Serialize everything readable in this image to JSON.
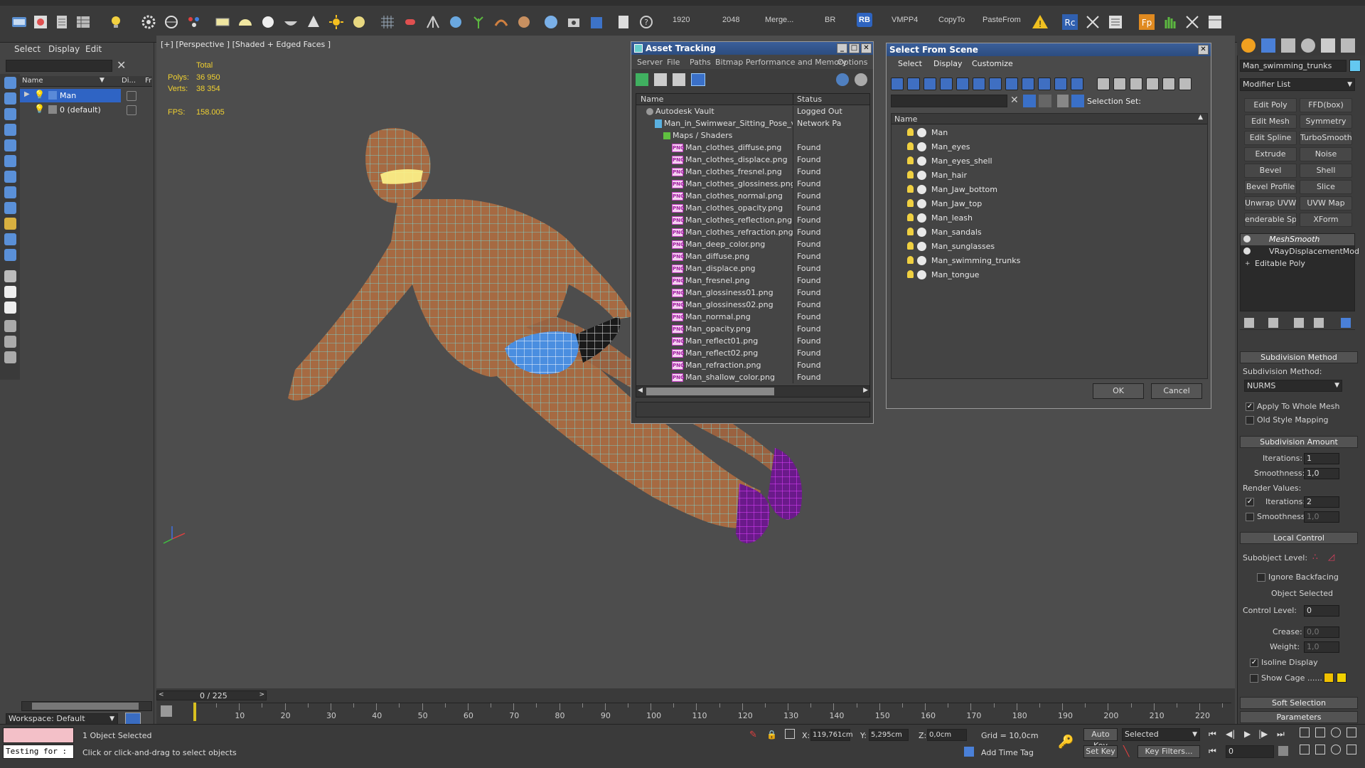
{
  "toolbar": {
    "texts": [
      "1920",
      "2048",
      "Merge...",
      "BR",
      "RB",
      "VMPP4",
      "CopyTo",
      "PasteFrom"
    ]
  },
  "explorer": {
    "menu": [
      "Select",
      "Display",
      "Edit"
    ],
    "col_name": "Name",
    "col_display": "Di...",
    "col_f": "Fr",
    "rows": [
      {
        "label": "Man",
        "selected": true
      },
      {
        "label": "0 (default)",
        "selected": false
      }
    ],
    "workspace": "Workspace: Default"
  },
  "viewport": {
    "label": "[+] [Perspective ] [Shaded + Edged Faces ]",
    "stats": {
      "total_label": "Total",
      "polys_label": "Polys:",
      "polys": "36 950",
      "verts_label": "Verts:",
      "verts": "38 354",
      "fps_label": "FPS:",
      "fps": "158.005"
    }
  },
  "asset_tracking": {
    "title": "Asset Tracking",
    "menu": [
      "Server",
      "File",
      "Paths",
      "Bitmap Performance and Memory",
      "Options"
    ],
    "col_name": "Name",
    "col_status": "Status",
    "rows": [
      {
        "name": "Autodesk Vault",
        "status": "Logged Out",
        "level": 0,
        "kind": "vault"
      },
      {
        "name": "Man_in_Swimwear_Sitting_Pose_vray...",
        "status": "Network Pa",
        "level": 1,
        "kind": "file"
      },
      {
        "name": "Maps / Shaders",
        "status": "",
        "level": 2,
        "kind": "folder"
      },
      {
        "name": "Man_clothes_diffuse.png",
        "status": "Found",
        "level": 3,
        "kind": "png"
      },
      {
        "name": "Man_clothes_displace.png",
        "status": "Found",
        "level": 3,
        "kind": "png"
      },
      {
        "name": "Man_clothes_fresnel.png",
        "status": "Found",
        "level": 3,
        "kind": "png"
      },
      {
        "name": "Man_clothes_glossiness.png",
        "status": "Found",
        "level": 3,
        "kind": "png"
      },
      {
        "name": "Man_clothes_normal.png",
        "status": "Found",
        "level": 3,
        "kind": "png"
      },
      {
        "name": "Man_clothes_opacity.png",
        "status": "Found",
        "level": 3,
        "kind": "png"
      },
      {
        "name": "Man_clothes_reflection.png",
        "status": "Found",
        "level": 3,
        "kind": "png"
      },
      {
        "name": "Man_clothes_refraction.png",
        "status": "Found",
        "level": 3,
        "kind": "png"
      },
      {
        "name": "Man_deep_color.png",
        "status": "Found",
        "level": 3,
        "kind": "png"
      },
      {
        "name": "Man_diffuse.png",
        "status": "Found",
        "level": 3,
        "kind": "png"
      },
      {
        "name": "Man_displace.png",
        "status": "Found",
        "level": 3,
        "kind": "png"
      },
      {
        "name": "Man_fresnel.png",
        "status": "Found",
        "level": 3,
        "kind": "png"
      },
      {
        "name": "Man_glossiness01.png",
        "status": "Found",
        "level": 3,
        "kind": "png"
      },
      {
        "name": "Man_glossiness02.png",
        "status": "Found",
        "level": 3,
        "kind": "png"
      },
      {
        "name": "Man_normal.png",
        "status": "Found",
        "level": 3,
        "kind": "png"
      },
      {
        "name": "Man_opacity.png",
        "status": "Found",
        "level": 3,
        "kind": "png"
      },
      {
        "name": "Man_reflect01.png",
        "status": "Found",
        "level": 3,
        "kind": "png"
      },
      {
        "name": "Man_reflect02.png",
        "status": "Found",
        "level": 3,
        "kind": "png"
      },
      {
        "name": "Man_refraction.png",
        "status": "Found",
        "level": 3,
        "kind": "png"
      },
      {
        "name": "Man_shallow_color.png",
        "status": "Found",
        "level": 3,
        "kind": "png"
      }
    ]
  },
  "select_scene": {
    "title": "Select From Scene",
    "menu": [
      "Select",
      "Display",
      "Customize"
    ],
    "selection_set_label": "Selection Set:",
    "col_name": "Name",
    "items": [
      "Man",
      "Man_eyes",
      "Man_eyes_shell",
      "Man_hair",
      "Man_Jaw_bottom",
      "Man_Jaw_top",
      "Man_leash",
      "Man_sandals",
      "Man_sunglasses",
      "Man_swimming_trunks",
      "Man_tongue"
    ],
    "ok": "OK",
    "cancel": "Cancel"
  },
  "command_panel": {
    "object_name": "Man_swimming_trunks",
    "object_color": "#64c8f0",
    "modifier_list": "Modifier List",
    "mod_buttons": [
      "Edit Poly",
      "FFD(box)",
      "Edit Mesh",
      "Symmetry",
      "Edit Spline",
      "TurboSmooth",
      "Extrude",
      "Noise",
      "Bevel",
      "Shell",
      "Bevel Profile",
      "Slice",
      "Unwrap UVW",
      "UVW Map",
      "enderable Splin",
      "XForm"
    ],
    "stack": [
      "MeshSmooth",
      "VRayDisplacementMod",
      "Editable Poly"
    ],
    "subdiv_method_title": "Subdivision Method",
    "subdiv_method_label": "Subdivision Method:",
    "subdiv_method_value": "NURMS",
    "apply_whole_mesh": "Apply To Whole Mesh",
    "old_style_mapping": "Old Style Mapping",
    "subdiv_amount_title": "Subdivision Amount",
    "iterations_label": "Iterations:",
    "iterations": "1",
    "smoothness_label": "Smoothness:",
    "smoothness": "1,0",
    "render_values_label": "Render Values:",
    "render_iterations_label": "Iterations:",
    "render_iterations": "2",
    "render_smoothness_label": "Smoothness:",
    "render_smoothness": "1,0",
    "local_control_title": "Local Control",
    "subobject_level_label": "Subobject Level:",
    "ignore_backfacing": "Ignore Backfacing",
    "object_selected": "Object Selected",
    "control_level_label": "Control Level:",
    "control_level": "0",
    "crease_label": "Crease:",
    "crease": "0,0",
    "weight_label": "Weight:",
    "weight": "1,0",
    "isoline_display": "Isoline Display",
    "show_cage": "Show Cage ......",
    "soft_selection_title": "Soft Selection",
    "parameters_title": "Parameters"
  },
  "timeline": {
    "frame_counter": "0 / 225",
    "ticks": [
      "10",
      "20",
      "30",
      "40",
      "50",
      "60",
      "70",
      "80",
      "90",
      "100",
      "110",
      "120",
      "130",
      "140",
      "150",
      "160",
      "170",
      "180",
      "190",
      "200",
      "210",
      "220"
    ]
  },
  "statusbar": {
    "maxscript": "Testing for :",
    "selected": "1 Object Selected",
    "prompt": "Click or click-and-drag to select objects",
    "x_label": "X:",
    "x": "119,761cm",
    "y_label": "Y:",
    "y": "5,295cm",
    "z_label": "Z:",
    "z": "0,0cm",
    "grid": "Grid = 10,0cm",
    "add_time_tag": "Add Time Tag",
    "auto_key": "Auto Key",
    "set_key": "Set Key",
    "selected_dropdown": "Selected",
    "key_filters": "Key Filters...",
    "frame_field": "0"
  }
}
